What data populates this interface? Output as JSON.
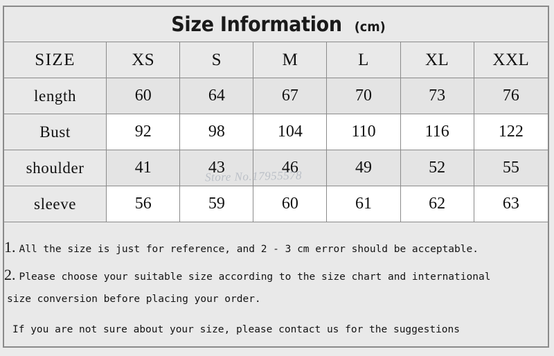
{
  "title": {
    "main": "Size Information",
    "unit": "(cm)"
  },
  "table": {
    "corner_label": "SIZE",
    "columns": [
      "XS",
      "S",
      "M",
      "L",
      "XL",
      "XXL"
    ],
    "rows": [
      {
        "label": "length",
        "values": [
          "60",
          "64",
          "67",
          "70",
          "73",
          "76"
        ]
      },
      {
        "label": "Bust",
        "values": [
          "92",
          "98",
          "104",
          "110",
          "116",
          "122"
        ]
      },
      {
        "label": "shoulder",
        "values": [
          "41",
          "43",
          "46",
          "49",
          "52",
          "55"
        ]
      },
      {
        "label": "sleeve",
        "values": [
          "56",
          "59",
          "60",
          "61",
          "62",
          "63"
        ]
      }
    ]
  },
  "notes": {
    "note1_num": "1.",
    "note1_text": "All the size is just for reference, and 2 - 3 cm error should be acceptable.",
    "note2_num": "2.",
    "note2_text": "Please choose your suitable size according to the size chart and international",
    "note2_text_cont": "size conversion before placing your order.",
    "note3_text": "If you are not sure about your size, please contact us for the suggestions"
  },
  "watermark": {
    "text": "Store No.17955578"
  },
  "colors": {
    "page_background": "#ebebeb",
    "cell_shaded": "#e4e4e4",
    "cell_plain": "#ffffff",
    "border": "#8a8a8a",
    "text": "#111111"
  }
}
